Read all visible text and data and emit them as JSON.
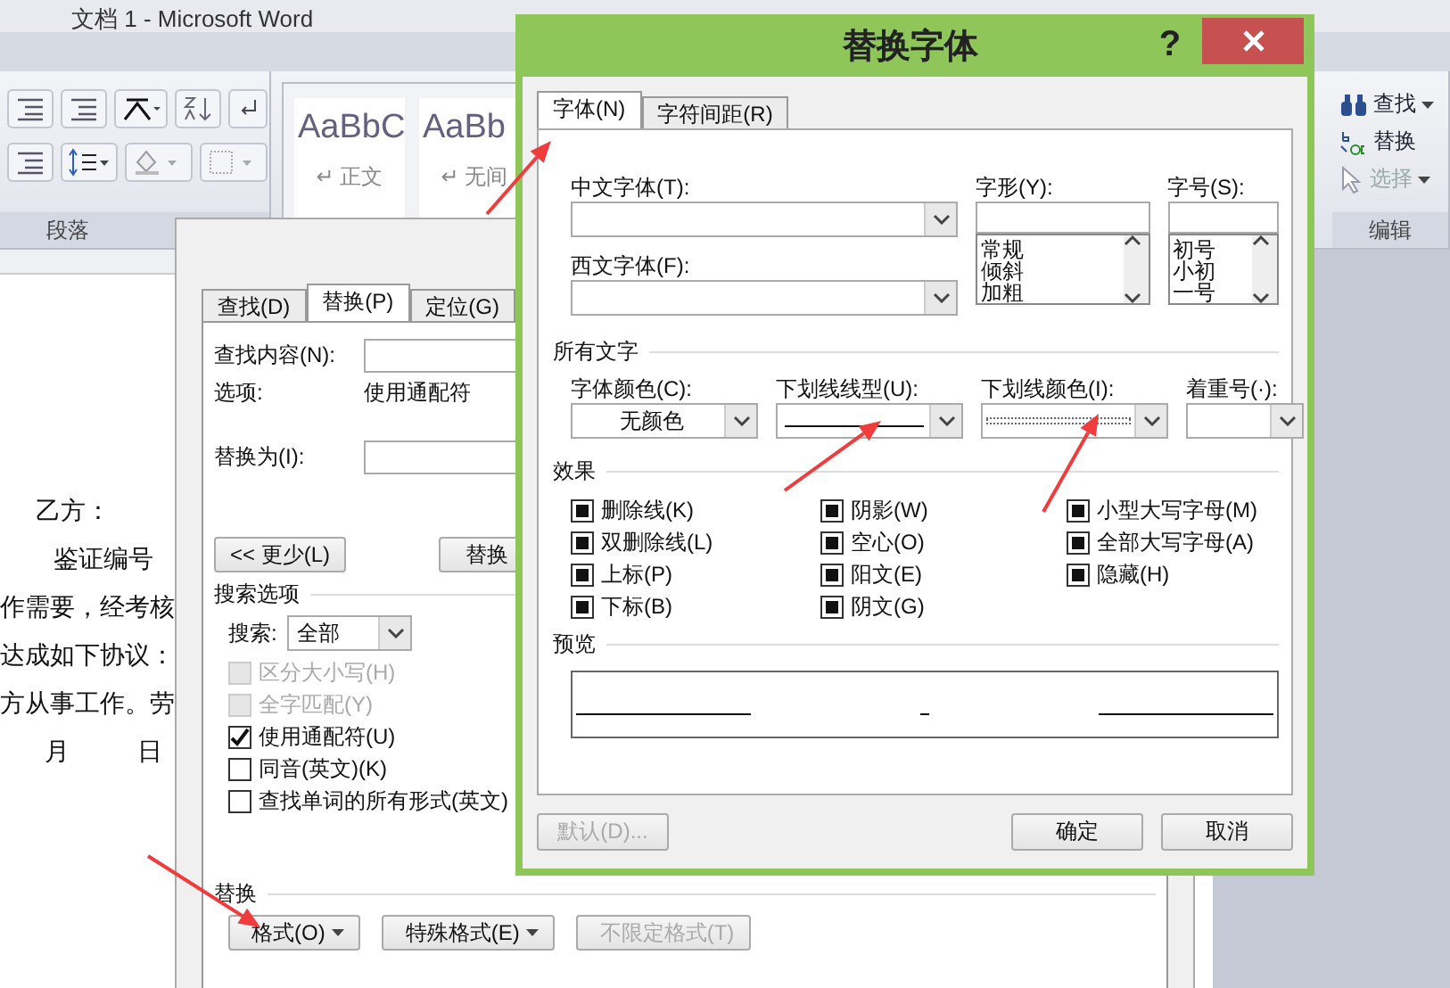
{
  "word": {
    "title": "文档 1 - Microsoft Word",
    "styles": [
      {
        "sample": "AaBbC",
        "name": "↵ 正文"
      },
      {
        "sample": "AaBb",
        "name": "↵ 无间"
      }
    ],
    "paragraph_group": "段落",
    "editing_group": "编辑",
    "edit_commands": [
      {
        "label": "查找",
        "kind": "find",
        "disabled": false,
        "has_menu": true
      },
      {
        "label": "替换",
        "kind": "replace",
        "disabled": false,
        "has_menu": false
      },
      {
        "label": "选择",
        "kind": "select",
        "disabled": true,
        "has_menu": true
      }
    ],
    "document_lines": [
      {
        "kind": "party",
        "parts": [
          "乙方："
        ]
      },
      {
        "kind": "number",
        "parts": [
          "鉴证编号"
        ]
      },
      {
        "kind": "body",
        "parts": [
          "作需要，经考核"
        ]
      },
      {
        "kind": "body",
        "parts": [
          "达成如下协议："
        ]
      },
      {
        "kind": "body",
        "parts": [
          "方从事工作。劳"
        ]
      },
      {
        "kind": "date",
        "parts": [
          "月",
          "日"
        ]
      }
    ]
  },
  "find_replace": {
    "tabs": [
      {
        "label": "查找(D)",
        "selected": false
      },
      {
        "label": "替换(P)",
        "selected": true
      },
      {
        "label": "定位(G)",
        "selected": false
      }
    ],
    "find_label": "查找内容(N):",
    "options_label": "选项:",
    "options_value": "使用通配符",
    "replace_label": "替换为(I):",
    "less_button": "<< 更少(L)",
    "replace_button": "替换",
    "search_options_title": "搜索选项",
    "search_label": "搜索:",
    "search_value": "全部",
    "options": [
      {
        "label": "区分大小写(H)",
        "checked": false,
        "disabled": true
      },
      {
        "label": "全字匹配(Y)",
        "checked": false,
        "disabled": true
      },
      {
        "label": "使用通配符(U)",
        "checked": true,
        "disabled": false
      },
      {
        "label": "同音(英文)(K)",
        "checked": false,
        "disabled": false
      },
      {
        "label": "查找单词的所有形式(英文)",
        "checked": false,
        "disabled": false
      }
    ],
    "replace_section": "替换",
    "bottom_buttons": [
      {
        "label": "格式(O)",
        "has_menu": true,
        "disabled": false
      },
      {
        "label": "特殊格式(E)",
        "has_menu": true,
        "disabled": false
      },
      {
        "label": "不限定格式(T)",
        "has_menu": false,
        "disabled": true
      }
    ]
  },
  "font_dialog": {
    "title": "替换字体",
    "help": "?",
    "tabs": [
      {
        "label": "字体(N)",
        "selected": true
      },
      {
        "label": "字符间距(R)",
        "selected": false
      }
    ],
    "chinese_font_label": "中文字体(T):",
    "western_font_label": "西文字体(F):",
    "style_label": "字形(Y):",
    "style_options": [
      "常规",
      "倾斜",
      "加粗"
    ],
    "size_label": "字号(S):",
    "size_options": [
      "初号",
      "小初",
      "一号"
    ],
    "all_text_title": "所有文字",
    "font_color_label": "字体颜色(C):",
    "font_color_value": "无颜色",
    "underline_style_label": "下划线线型(U):",
    "underline_color_label": "下划线颜色(I):",
    "emphasis_label": "着重号(·):",
    "effects_title": "效果",
    "effects": [
      {
        "label": "删除线(K)",
        "mixed": true
      },
      {
        "label": "双删除线(L)",
        "mixed": true
      },
      {
        "label": "上标(P)",
        "mixed": true
      },
      {
        "label": "下标(B)",
        "mixed": true
      },
      {
        "label": "阴影(W)",
        "mixed": true
      },
      {
        "label": "空心(O)",
        "mixed": true
      },
      {
        "label": "阳文(E)",
        "mixed": true
      },
      {
        "label": "阴文(G)",
        "mixed": true
      },
      {
        "label": "小型大写字母(M)",
        "mixed": true
      },
      {
        "label": "全部大写字母(A)",
        "mixed": true
      },
      {
        "label": "隐藏(H)",
        "mixed": true
      }
    ],
    "preview_title": "预览",
    "buttons": [
      {
        "label": "默认(D)...",
        "disabled": true
      },
      {
        "label": "确定",
        "disabled": false
      },
      {
        "label": "取消",
        "disabled": false
      }
    ]
  }
}
